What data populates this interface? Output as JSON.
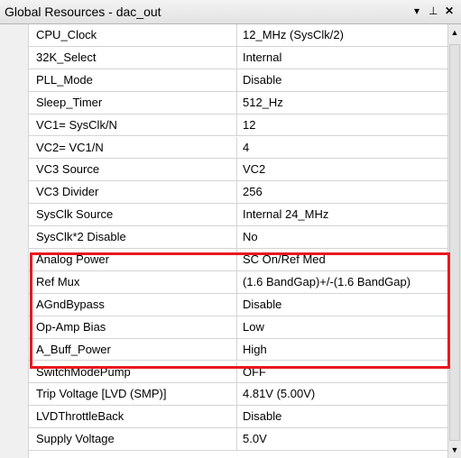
{
  "window": {
    "title": "Global Resources - dac_out",
    "dropdown_glyph": "▾",
    "pin_glyph": "⊥",
    "close_glyph": "✕"
  },
  "properties": [
    {
      "name": "CPU_Clock",
      "value": "12_MHz (SysClk/2)"
    },
    {
      "name": "32K_Select",
      "value": "Internal"
    },
    {
      "name": "PLL_Mode",
      "value": "Disable"
    },
    {
      "name": "Sleep_Timer",
      "value": "512_Hz"
    },
    {
      "name": "VC1= SysClk/N",
      "value": "12"
    },
    {
      "name": "VC2= VC1/N",
      "value": "4"
    },
    {
      "name": "VC3 Source",
      "value": "VC2"
    },
    {
      "name": "VC3 Divider",
      "value": "256"
    },
    {
      "name": "SysClk Source",
      "value": "Internal 24_MHz"
    },
    {
      "name": "SysClk*2 Disable",
      "value": "No"
    },
    {
      "name": "Analog Power",
      "value": "SC On/Ref Med"
    },
    {
      "name": "Ref Mux",
      "value": "(1.6 BandGap)+/-(1.6 BandGap)"
    },
    {
      "name": "AGndBypass",
      "value": "Disable"
    },
    {
      "name": "Op-Amp Bias",
      "value": "Low"
    },
    {
      "name": "A_Buff_Power",
      "value": "High"
    },
    {
      "name": "SwitchModePump",
      "value": "OFF"
    },
    {
      "name": "Trip Voltage [LVD (SMP)]",
      "value": "4.81V (5.00V)"
    },
    {
      "name": "LVDThrottleBack",
      "value": "Disable"
    },
    {
      "name": "Supply Voltage",
      "value": "5.0V"
    }
  ],
  "highlight_color": "#e8191f",
  "scrollbar": {
    "up_glyph": "▲",
    "down_glyph": "▼"
  }
}
